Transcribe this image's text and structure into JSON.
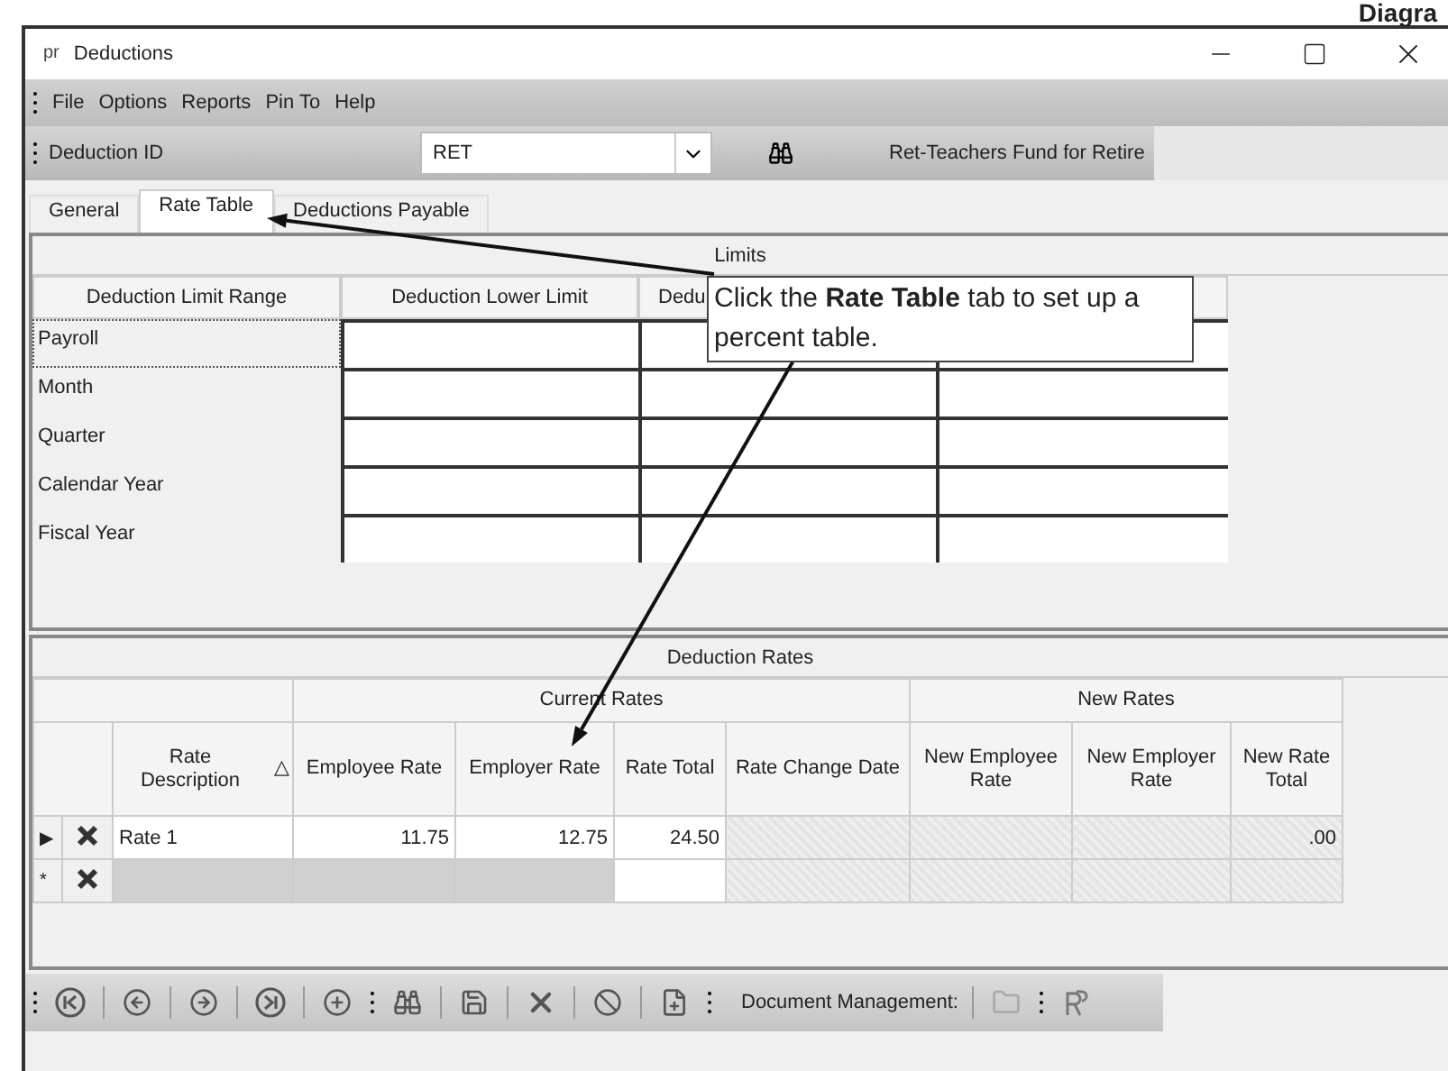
{
  "page_heading": "Diagra",
  "window": {
    "icon_text": "pr",
    "title": "Deductions"
  },
  "menu": [
    "File",
    "Options",
    "Reports",
    "Pin To",
    "Help"
  ],
  "id_bar": {
    "label": "Deduction ID",
    "value": "RET",
    "description": "Ret-Teachers Fund for Retire"
  },
  "tabs": [
    {
      "label": "General",
      "selected": false
    },
    {
      "label": "Rate Table",
      "selected": true
    },
    {
      "label": "Deductions Payable",
      "selected": false
    }
  ],
  "limits": {
    "title": "Limits",
    "columns": [
      "Deduction Limit Range",
      "Deduction Lower Limit",
      "Dedu"
    ],
    "rows": [
      {
        "label": "Payroll",
        "focused": true
      },
      {
        "label": "Month",
        "focused": false
      },
      {
        "label": "Quarter",
        "focused": false
      },
      {
        "label": "Calendar Year",
        "focused": false
      },
      {
        "label": "Fiscal Year",
        "focused": false
      }
    ]
  },
  "rates": {
    "title": "Deduction Rates",
    "groups": [
      "Current Rates",
      "New Rates"
    ],
    "columns": [
      "Rate Description",
      "Employee Rate",
      "Employer Rate",
      "Rate Total",
      "Rate Change Date",
      "New Employee Rate",
      "New Employer Rate",
      "New Rate Total"
    ],
    "sort_indicator": "△",
    "rows": [
      {
        "kind": "data",
        "marker": "▶",
        "description": "Rate 1",
        "employee_rate": "11.75",
        "employer_rate": "12.75",
        "rate_total": "24.50",
        "new_rate_total": ".00"
      },
      {
        "kind": "new",
        "marker": "*"
      }
    ]
  },
  "toolbar": {
    "document_label": "Document Management:"
  },
  "callout": {
    "text": "Click the **Rate Table** tab to set up a percent table."
  }
}
